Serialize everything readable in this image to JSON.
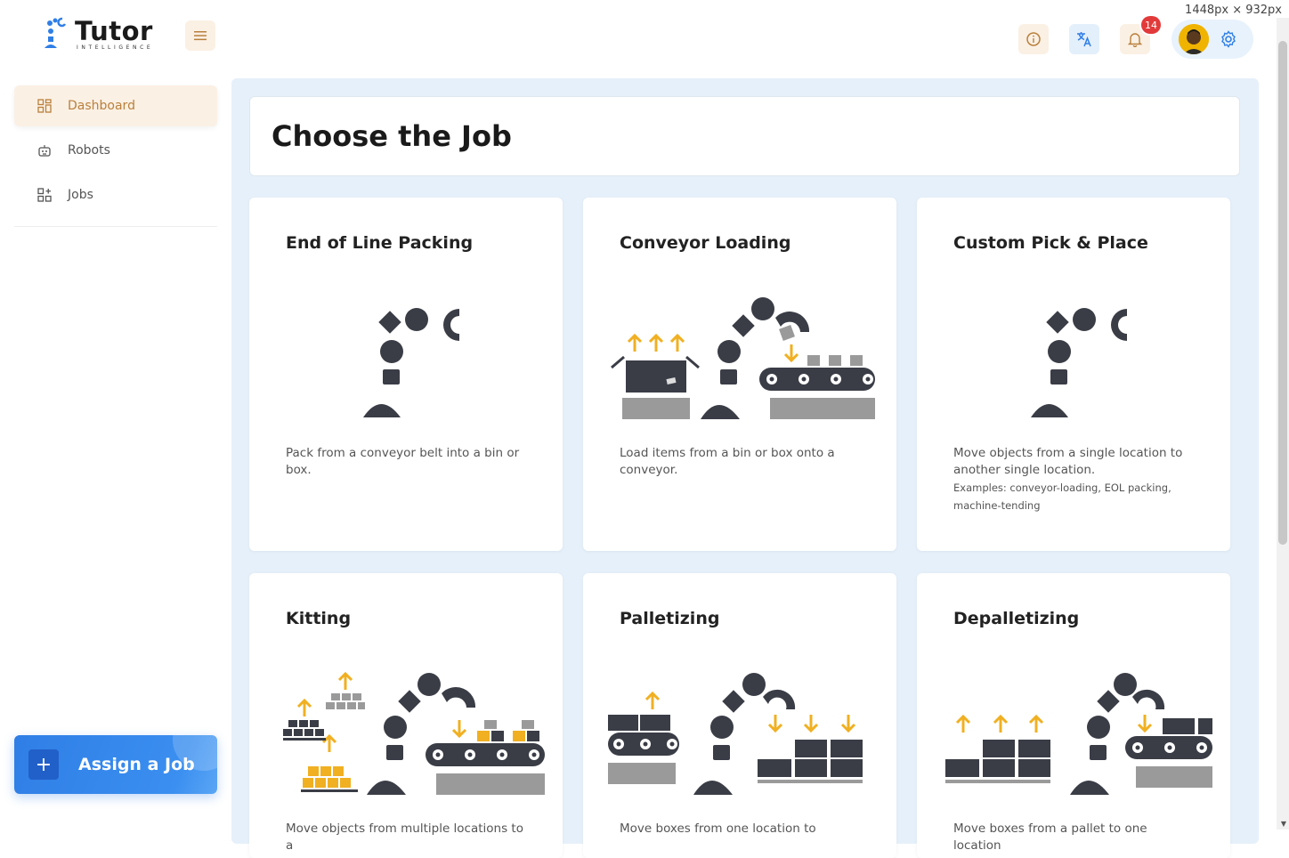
{
  "brand": {
    "name": "Tutor",
    "tagline": "INTELLIGENCE"
  },
  "header": {
    "notification_count": "14",
    "size_label": "1448px × 932px"
  },
  "sidebar": {
    "items": [
      {
        "label": "Dashboard",
        "icon": "dashboard-icon",
        "active": true
      },
      {
        "label": "Robots",
        "icon": "robot-icon",
        "active": false
      },
      {
        "label": "Jobs",
        "icon": "jobs-icon",
        "active": false
      }
    ],
    "assign_label": "Assign a Job",
    "assign_plus": "+"
  },
  "page": {
    "title": "Choose the Job"
  },
  "jobs": [
    {
      "title": "End of Line Packing",
      "description": "Pack from a conveyor belt into a bin or box.",
      "examples": ""
    },
    {
      "title": "Conveyor Loading",
      "description": "Load items from a bin or box onto a conveyor.",
      "examples": ""
    },
    {
      "title": "Custom Pick & Place",
      "description": "Move objects from a single location to another single location.",
      "examples": "Examples: conveyor-loading, EOL packing, machine-tending"
    },
    {
      "title": "Kitting",
      "description": "Move objects from multiple locations to a",
      "examples": ""
    },
    {
      "title": "Palletizing",
      "description": "Move boxes from one location to",
      "examples": ""
    },
    {
      "title": "Depalletizing",
      "description": "Move boxes from a pallet to one location",
      "examples": ""
    }
  ],
  "colors": {
    "accent_orange": "#b9803c",
    "brand_blue": "#2f7ee6",
    "robot_dark": "#3a3d46",
    "arrow_yellow": "#f0b022",
    "badge_red": "#e23a3a"
  }
}
